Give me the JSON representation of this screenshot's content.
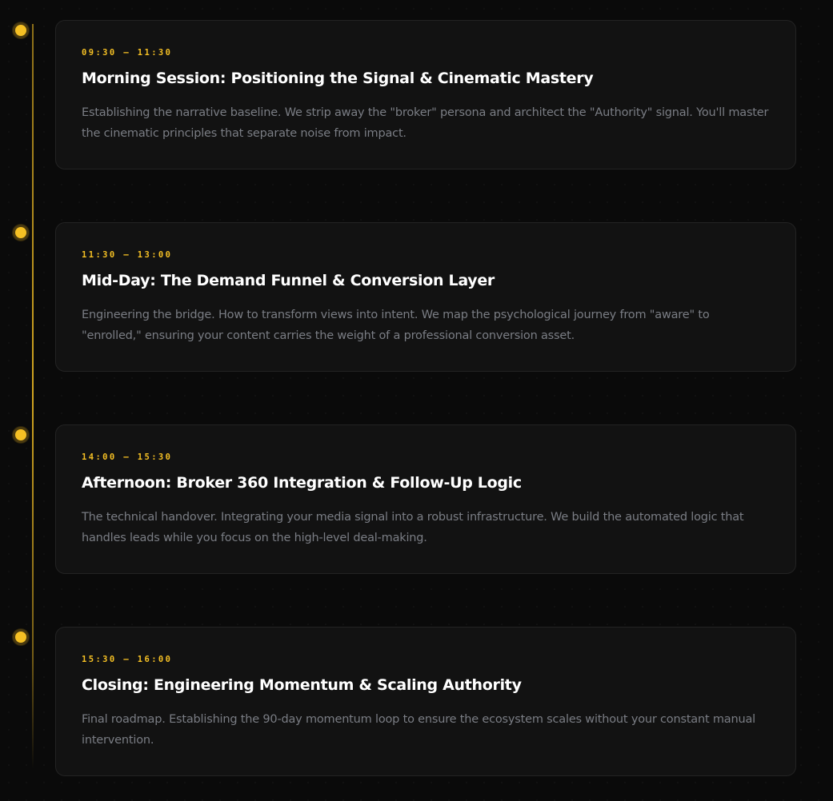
{
  "timeline": {
    "accent_color": "#f5c024",
    "sessions": [
      {
        "time": "09:30 — 11:30",
        "title": "Morning Session: Positioning the Signal & Cinematic Mastery",
        "description": "Establishing the narrative baseline. We strip away the \"broker\" persona and architect the \"Authority\" signal. You'll master the cinematic principles that separate noise from impact."
      },
      {
        "time": "11:30 — 13:00",
        "title": "Mid-Day: The Demand Funnel & Conversion Layer",
        "description": "Engineering the bridge. How to transform views into intent. We map the psychological journey from \"aware\" to \"enrolled,\" ensuring your content carries the weight of a professional conversion asset."
      },
      {
        "time": "14:00 — 15:30",
        "title": "Afternoon: Broker 360 Integration & Follow-Up Logic",
        "description": "The technical handover. Integrating your media signal into a robust infrastructure. We build the automated logic that handles leads while you focus on the high-level deal-making."
      },
      {
        "time": "15:30 — 16:00",
        "title": "Closing: Engineering Momentum & Scaling Authority",
        "description": "Final roadmap. Establishing the 90-day momentum loop to ensure the ecosystem scales without your constant manual intervention."
      }
    ]
  }
}
